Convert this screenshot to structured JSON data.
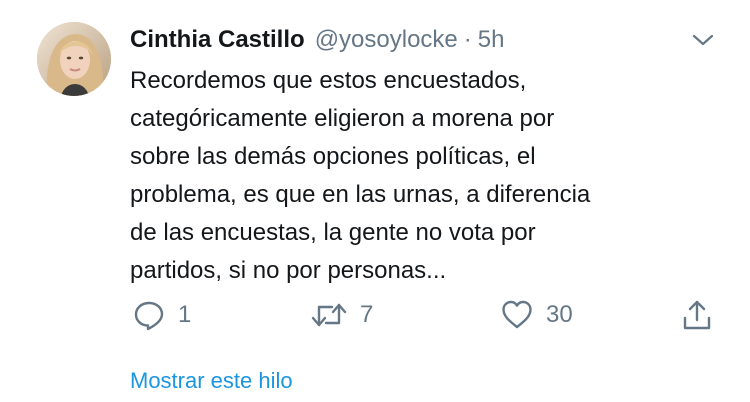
{
  "tweet": {
    "author_name": "Cinthia Castillo",
    "handle": "@yosoylocke",
    "separator": "·",
    "time": "5h",
    "text_lines": [
      "Recordemos que estos encuestados,",
      "categóricamente eligieron a morena por",
      "sobre las demás opciones políticas, el",
      "problema, es que en las urnas, a diferencia",
      "de las encuestas, la gente no vota por",
      "partidos, si no por personas..."
    ],
    "reply_count": "1",
    "retweet_count": "7",
    "like_count": "30",
    "show_thread_label": "Mostrar este hilo"
  },
  "colors": {
    "text": "#14171a",
    "secondary": "#657786",
    "link": "#1b95e0"
  },
  "icons": [
    "chevron-down-icon",
    "reply-icon",
    "retweet-icon",
    "heart-icon",
    "share-icon"
  ]
}
